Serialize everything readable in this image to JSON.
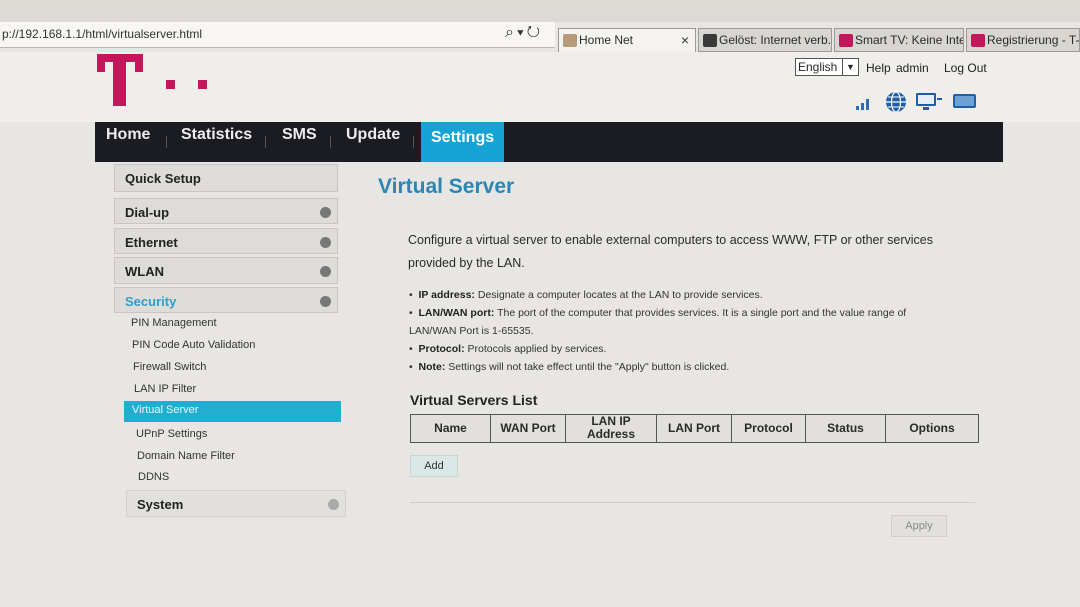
{
  "browser": {
    "url": "p://192.168.1.1/html/virtualserver.html",
    "tabs": [
      {
        "label": "Home Net",
        "close": "×",
        "color": "#b89a78"
      },
      {
        "label": "Gelöst: Internet verb...",
        "color": "#3a3a3a"
      },
      {
        "label": "Smart TV: Keine Inte...",
        "color": "#c2185b"
      },
      {
        "label": "Registrierung - T-M",
        "color": "#c2185b"
      }
    ]
  },
  "header": {
    "language": "English",
    "help": "Help",
    "user": "admin",
    "logout": "Log Out",
    "brand_color": "#c2185b",
    "status_icons": [
      "signal-icon",
      "globe-icon",
      "computer-icon",
      "battery-icon"
    ]
  },
  "nav": {
    "items": [
      "Home",
      "Statistics",
      "SMS",
      "Update",
      "Settings"
    ],
    "active": "Settings",
    "active_color": "#14a3d4"
  },
  "sidebar": {
    "quick_setup": "Quick Setup",
    "dialup": "Dial-up",
    "ethernet": "Ethernet",
    "wlan": "WLAN",
    "security": "Security",
    "security_items": [
      "PIN Management",
      "PIN Code Auto Validation",
      "Firewall Switch",
      "LAN IP Filter",
      "Virtual Server",
      "UPnP Settings",
      "Domain Name Filter",
      "DDNS"
    ],
    "active_item": "Virtual Server",
    "system": "System"
  },
  "main": {
    "title": "Virtual Server",
    "intro_line1": "Configure a virtual server to enable external computers to access WWW, FTP or other services",
    "intro_line2": "provided by the LAN.",
    "bullets": [
      {
        "term": "IP address:",
        "text": "Designate a computer locates at the LAN to provide services."
      },
      {
        "term": "LAN/WAN port:",
        "text": "The port of the computer that provides services. It is a single port and the value range of"
      },
      {
        "term": "",
        "text": "LAN/WAN Port is 1-65535."
      },
      {
        "term": "Protocol:",
        "text": "Protocols applied by services."
      },
      {
        "term": "Note:",
        "text": "Settings will not take effect until the \"Apply\" button is clicked."
      }
    ],
    "list_title": "Virtual Servers List",
    "columns": [
      "Name",
      "WAN Port",
      "LAN IP Address",
      "LAN Port",
      "Protocol",
      "Status",
      "Options"
    ],
    "add_label": "Add",
    "apply_label": "Apply"
  }
}
